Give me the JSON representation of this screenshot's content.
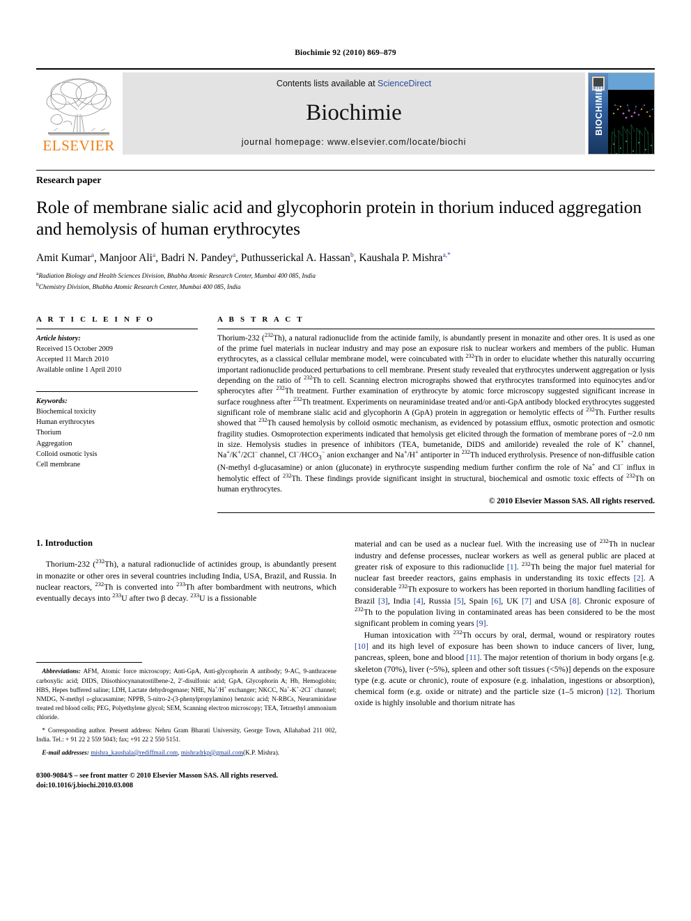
{
  "running_head": "Biochimie 92 (2010) 869–879",
  "banner": {
    "publisher_name": "ELSEVIER",
    "contents_prefix": "Contents lists available at ",
    "contents_link": "ScienceDirect",
    "journal_title": "Biochimie",
    "homepage": "journal homepage: www.elsevier.com/locate/biochi",
    "cover_title": "BIOCHIMIE"
  },
  "article": {
    "kind": "Research paper",
    "title": "Role of membrane sialic acid and glycophorin protein in thorium induced aggregation and hemolysis of human erythrocytes",
    "authors_html": "Amit Kumar<sup>a</sup>, Manjoor Ali<sup>a</sup>, Badri N. Pandey<sup>a</sup>, Puthusserickal A. Hassan<sup>b</sup>, Kaushala P. Mishra<sup>a,*</sup>",
    "affiliations": [
      "Radiation Biology and Health Sciences Division, Bhabha Atomic Research Center, Mumbai 400 085, India",
      "Chemistry Division, Bhabha Atomic Research Center, Mumbai 400 085, India"
    ],
    "affiliation_marks": [
      "a",
      "b"
    ]
  },
  "article_info": {
    "heading": "A R T I C L E  I N F O",
    "history_label": "Article history:",
    "history": [
      "Received 15 October 2009",
      "Accepted 11 March 2010",
      "Available online 1 April 2010"
    ],
    "keywords_label": "Keywords:",
    "keywords": [
      "Biochemical toxicity",
      "Human erythrocytes",
      "Thorium",
      "Aggregation",
      "Colloid osmotic lysis",
      "Cell membrane"
    ]
  },
  "abstract": {
    "heading": "A B S T R A C T",
    "text_html": "Thorium-232 (<sup>232</sup>Th), a natural radionuclide from the actinide family, is abundantly present in monazite and other ores. It is used as one of the prime fuel materials in nuclear industry and may pose an exposure risk to nuclear workers and members of the public. Human erythrocytes, as a classical cellular membrane model, were coincubated with <sup>232</sup>Th in order to elucidate whether this naturally occurring important radionuclide produced perturbations to cell membrane. Present study revealed that erythrocytes underwent aggregation or lysis depending on the ratio of <sup>232</sup>Th to cell. Scanning electron micrographs showed that erythrocytes transformed into equinocytes and/or spherocytes after <sup>232</sup>Th treatment. Further examination of erythrocyte by atomic force microscopy suggested significant increase in surface roughness after <sup>232</sup>Th treatment. Experiments on neuraminidase treated and/or anti-GpA antibody blocked erythrocytes suggested significant role of membrane sialic acid and glycophorin A (GpA) protein in aggregation or hemolytic effects of <sup>232</sup>Th. Further results showed that <sup>232</sup>Th caused hemolysis by colloid osmotic mechanism, as evidenced by potassium efflux, osmotic protection and osmotic fragility studies. Osmoprotection experiments indicated that hemolysis get elicited through the formation of membrane pores of ~2.0 nm in size. Hemolysis studies in presence of inhibitors (TEA, bumetanide, DIDS and amiloride) revealed the role of K<sup>+</sup> channel, Na<sup>+</sup>/K<sup>+</sup>/2Cl<sup>−</sup> channel, Cl<sup>−</sup>/HCO<sub>3</sub><sup>−</sup> anion exchanger and Na<sup>+</sup>/H<sup>+</sup> antiporter in <sup>232</sup>Th induced erythrolysis. Presence of non-diffusible cation (N-methyl <span class=\"small-caps\">d</span>-glucasamine) or anion (gluconate) in erythrocyte suspending medium further confirm the role of Na<sup>+</sup> and Cl<sup>−</sup> influx in hemolytic effect of <sup>232</sup>Th. These findings provide significant insight in structural, biochemical and osmotic toxic effects of <sup>232</sup>Th on human erythrocytes.",
    "copyright": "© 2010 Elsevier Masson SAS. All rights reserved."
  },
  "introduction": {
    "heading": "1. Introduction",
    "left_paragraph_html": "Thorium-232 (<sup>232</sup>Th), a natural radionuclide of actinides group, is abundantly present in monazite or other ores in several countries including India, USA, Brazil, and Russia. In nuclear reactors, <sup>232</sup>Th is converted into <sup>233</sup>Th after bombardment with neutrons, which eventually decays into <sup>233</sup>U after two β decay. <sup>233</sup>U is a fissionable",
    "right_paragraph_1_html": "material and can be used as a nuclear fuel. With the increasing use of <sup>232</sup>Th in nuclear industry and defense processes, nuclear workers as well as general public are placed at greater risk of exposure to this radionuclide <span class=\"ref\">[1]</span>. <sup>232</sup>Th being the major fuel material for nuclear fast breeder reactors, gains emphasis in understanding its toxic effects <span class=\"ref\">[2]</span>. A considerable <sup>232</sup>Th exposure to workers has been reported in thorium handling facilities of Brazil <span class=\"ref\">[3]</span>, India <span class=\"ref\">[4]</span>, Russia <span class=\"ref\">[5]</span>, Spain <span class=\"ref\">[6]</span>, UK <span class=\"ref\">[7]</span> and USA <span class=\"ref\">[8]</span>. Chronic exposure of <sup>232</sup>Th to the population living in contaminated areas has been considered to be the most significant problem in coming years <span class=\"ref\">[9]</span>.",
    "right_paragraph_2_html": "Human intoxication with <sup>232</sup>Th occurs by oral, dermal, wound or respiratory routes <span class=\"ref\">[10]</span> and its high level of exposure has been shown to induce cancers of liver, lung, pancreas, spleen, bone and blood <span class=\"ref\">[11]</span>. The major retention of thorium in body organs [e.g. skeleton (70%), liver (~5%), spleen and other soft tissues (&lt;5%)] depends on the exposure type (e.g. acute or chronic), route of exposure (e.g. inhalation, ingestions or absorption), chemical form (e.g. oxide or nitrate) and the particle size (1–5 micron) <span class=\"ref\">[12]</span>. Thorium oxide is highly insoluble and thorium nitrate has"
  },
  "footnotes": {
    "abbreviations_label": "Abbreviations:",
    "abbreviations_html": "AFM, Atomic force microscopy; Anti-GpA, Anti-glycophorin A antibody; 9-AC, 9-anthracene carboxylic acid; DIDS, Diisothiocynanatostilbene-2, 2′-disulfonic acid; GpA, Glycophorin A; Hb, Hemoglobin; HBS, Hepes buffered saline; LDH, Lactate dehydrogenase; NHE, Na<sup>+</sup>/H<sup>+</sup> exchanger; NKCC, Na<sup>+</sup>-K<sup>+</sup>-2Cl<sup>−</sup> channel; NMDG, N-methyl <span class=\"small-caps\">d</span>-glucasamine; NPPB, 5-nitro-2-(3-phenylpropylamino) benzoic acid; N-RBCs, Neuraminidase treated red blood cells; PEG, Polyethylene glycol; SEM, Scanning electron microscopy; TEA, Tetraethyl ammonium chloride.",
    "corresponding_html": "* Corresponding author. Present address: Nehru Gram Bharati University, George Town, Allahabad 211 002, India. Tel.: + 91 22 2 559 5043; fax; +91 22 2 550 5151.",
    "email_label": "E-mail addresses:",
    "emails": [
      "mishra_kaushala@rediffmail.com",
      "mishradrkp@gmail.com"
    ],
    "email_owner": "(K.P. Mishra).",
    "issn_line": "0300-9084/$ – see front matter © 2010 Elsevier Masson SAS. All rights reserved.",
    "doi_line": "doi:10.1016/j.biochi.2010.03.008"
  }
}
